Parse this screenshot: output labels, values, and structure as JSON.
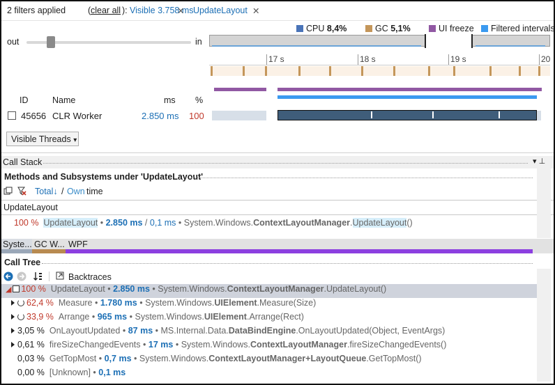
{
  "filters": {
    "count_text": "2 filters applied",
    "clear_label": "clear all",
    "clear_wrap_open": "(",
    "clear_wrap_close": "):",
    "filter1": "Visible 3.758 ms",
    "filter2": "UpdateLayout",
    "close_glyph": "✕"
  },
  "legend": {
    "cpu_label": "CPU",
    "cpu_value": "8,4%",
    "gc_label": "GC",
    "gc_value": "5,1%",
    "freeze_label": "UI freeze",
    "filtered_label": "Filtered intervals",
    "colors": {
      "cpu": "#4a74b8",
      "gc": "#c4965a",
      "freeze": "#9158a3",
      "filtered": "#3b9af0"
    }
  },
  "zoom": {
    "out_label": "out",
    "in_label": "in",
    "level": 0.15
  },
  "ruler": {
    "ticks": [
      "17 s",
      "18 s",
      "19 s",
      "20"
    ]
  },
  "threads": {
    "headers": {
      "id": "ID",
      "name": "Name",
      "ms": "ms",
      "pct": "%"
    },
    "rows": [
      {
        "id": "45656",
        "name": "CLR Worker",
        "ms": "2.850 ms",
        "pct": "100"
      }
    ],
    "visible_threads_label": "Visible Threads",
    "dropdown_glyph": "▾"
  },
  "call_stack": {
    "title": "Call Stack",
    "pin_glyph": "▾ ⊥",
    "methods_title": "Methods and Subsystems under 'UpdateLayout'",
    "total_label": "Total",
    "total_arrow": "↓",
    "sep": "/",
    "own_label": "Own",
    "time_label": "time",
    "search_value": "UpdateLayout",
    "search_clear": "✕",
    "summary": {
      "pct": "100 %",
      "method": "UpdateLayout",
      "bullet1": "•",
      "total_ms": "2.850 ms",
      "slash": "/",
      "own_ms": "0,1 ms",
      "bullet2": "•",
      "ns": "System.Windows.",
      "cls": "ContextLayoutManager",
      "dot": ".",
      "fn": "UpdateLayout",
      "tail": "()"
    }
  },
  "subsystems": {
    "items": [
      "Syste...",
      "GC W...",
      "WPF"
    ],
    "colors": [
      "#9aa7b8",
      "#b88a50",
      "#8c3fe0"
    ]
  },
  "call_tree": {
    "title": "Call Tree",
    "backtraces_label": "Backtraces",
    "rows": [
      {
        "pct": "100 %",
        "name": "UpdateLayout",
        "ms": "2.850 ms",
        "ns": "System.Windows.",
        "cls": "ContextLayoutManager",
        "fn": ".UpdateLayout()",
        "expanded": true,
        "recursive": false,
        "pct_red": true
      },
      {
        "pct": "62,4 %",
        "name": "Measure",
        "ms": "1.780 ms",
        "ns": "System.Windows.",
        "cls": "UIElement",
        "fn": ".Measure(Size)",
        "expanded": false,
        "recursive": true,
        "pct_red": true
      },
      {
        "pct": "33,9 %",
        "name": "Arrange",
        "ms": "965 ms",
        "ns": "System.Windows.",
        "cls": "UIElement",
        "fn": ".Arrange(Rect)",
        "expanded": false,
        "recursive": true,
        "pct_red": true
      },
      {
        "pct": "3,05 %",
        "name": "OnLayoutUpdated",
        "ms": "87 ms",
        "ns": "MS.Internal.Data.",
        "cls": "DataBindEngine",
        "fn": ".OnLayoutUpdated(Object, EventArgs)",
        "expanded": false,
        "recursive": false,
        "pct_red": false
      },
      {
        "pct": "0,61 %",
        "name": "fireSizeChangedEvents",
        "ms": "17 ms",
        "ns": "System.Windows.",
        "cls": "ContextLayoutManager",
        "fn": ".fireSizeChangedEvents()",
        "expanded": false,
        "recursive": false,
        "pct_red": false
      },
      {
        "pct": "0,03 %",
        "name": "GetTopMost",
        "ms": "0,7 ms",
        "ns": "System.Windows.",
        "cls": "ContextLayoutManager+LayoutQueue",
        "fn": ".GetTopMost()",
        "expanded": false,
        "recursive": false,
        "pct_red": false,
        "leaf": true
      },
      {
        "pct": "0,00 %",
        "name": "[Unknown]",
        "ms": "0,1 ms",
        "ns": "",
        "cls": "",
        "fn": "",
        "expanded": false,
        "recursive": false,
        "pct_red": false,
        "leaf": true
      }
    ]
  }
}
